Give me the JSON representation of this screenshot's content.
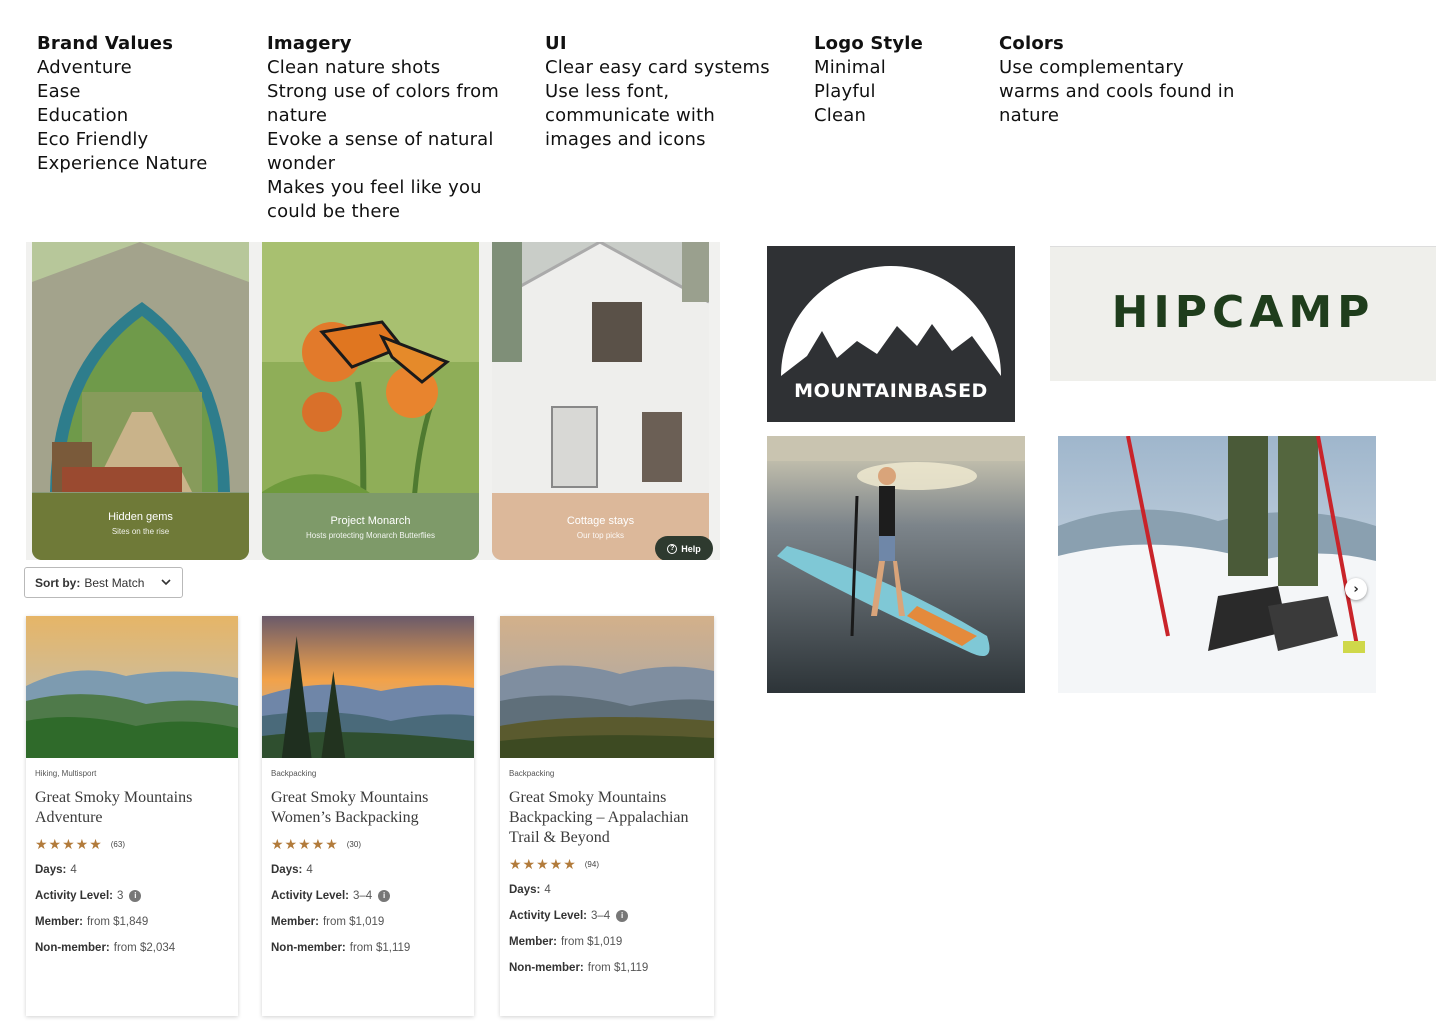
{
  "columns": {
    "brand": {
      "heading": "Brand Values",
      "lines": [
        "Adventure",
        "Ease",
        "Education",
        "Eco Friendly",
        "Experience Nature"
      ]
    },
    "imagery": {
      "heading": "Imagery",
      "lines": [
        "Clean nature shots",
        "Strong use of colors from",
        "nature",
        "Evoke a sense of natural",
        "wonder",
        "Makes you feel like you",
        "could be there"
      ]
    },
    "ui": {
      "heading": "UI",
      "lines": [
        "Clear easy card systems",
        "Use less font,",
        "communicate with",
        "images and icons"
      ]
    },
    "logo": {
      "heading": "Logo Style",
      "lines": [
        "Minimal",
        "Playful",
        "Clean"
      ]
    },
    "colors": {
      "heading": "Colors",
      "lines": [
        "Use complementary",
        "warms and cools found in",
        "nature"
      ]
    }
  },
  "promos": [
    {
      "title": "Hidden gems",
      "subtitle": "Sites on the rise",
      "color": "#6f7a38"
    },
    {
      "title": "Project Monarch",
      "subtitle": "Hosts protecting Monarch Butterflies",
      "color": "#7e9a69"
    },
    {
      "title": "Cottage stays",
      "subtitle": "Our top picks",
      "color": "#dcb89a"
    }
  ],
  "help": {
    "label": "Help"
  },
  "sort": {
    "label": "Sort by:",
    "value": "Best Match"
  },
  "trips": [
    {
      "category": "Hiking, Multisport",
      "title": "Great Smoky Mountains Adventure",
      "stars": "★★★★★",
      "count": "(63)",
      "days_label": "Days:",
      "days": "4",
      "activity_label": "Activity Level:",
      "activity": "3",
      "member_label": "Member:",
      "member": "from $1,849",
      "nonmember_label": "Non-member:",
      "nonmember": "from $2,034"
    },
    {
      "category": "Backpacking",
      "title": "Great Smoky Mountains Women’s Backpacking",
      "stars": "★★★★★",
      "count": "(30)",
      "days_label": "Days:",
      "days": "4",
      "activity_label": "Activity Level:",
      "activity": "3–4",
      "member_label": "Member:",
      "member": "from $1,019",
      "nonmember_label": "Non-member:",
      "nonmember": "from $1,119"
    },
    {
      "category": "Backpacking",
      "title": "Great Smoky Mountains Backpacking – Appalachian Trail & Beyond",
      "stars": "★★★★★",
      "count": "(94)",
      "days_label": "Days:",
      "days": "4",
      "activity_label": "Activity Level:",
      "activity": "3–4",
      "member_label": "Member:",
      "member": "from $1,019",
      "nonmember_label": "Non-member:",
      "nonmember": "from $1,119"
    }
  ],
  "logos": {
    "mountainbased": "MOUNTAINBASED",
    "hipcamp": "HIPCAMP"
  },
  "icons": {
    "info": "info-icon",
    "chevron": "chevron-down-icon",
    "next": "chevron-right-icon",
    "help": "question-icon"
  }
}
